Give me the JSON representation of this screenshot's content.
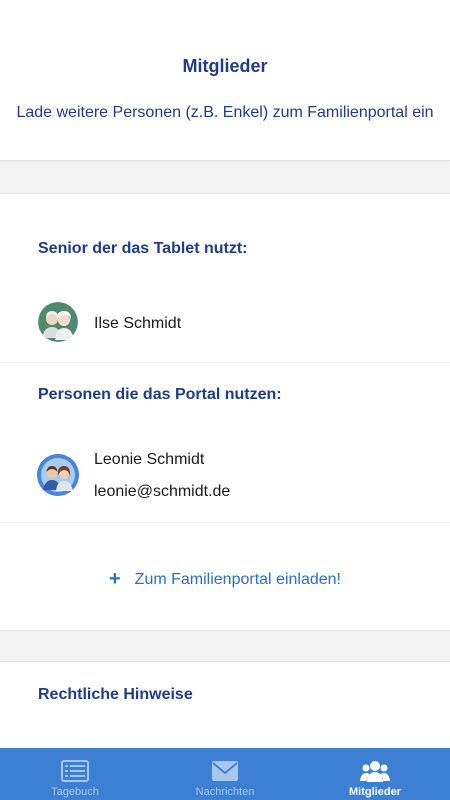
{
  "header": {
    "title": "Mitglieder",
    "subtitle": "Lade weitere Personen (z.B. Enkel) zum Familienportal ein"
  },
  "senior_section": {
    "title": "Senior der das Tablet nutzt:",
    "member": {
      "name": "Ilse Schmidt",
      "avatar": "senior-couple-avatar"
    }
  },
  "portal_section": {
    "title": "Personen die das Portal nutzen:",
    "members": [
      {
        "name": "Leonie Schmidt",
        "email": "leonie@schmidt.de",
        "avatar": "family-avatar"
      }
    ]
  },
  "invite": {
    "icon": "plus-icon",
    "label": "Zum Familienportal einladen!"
  },
  "legal": {
    "title": "Rechtliche Hinweise"
  },
  "bottom_nav": {
    "items": [
      {
        "label": "Tagebuch",
        "icon": "diary-icon",
        "active": false
      },
      {
        "label": "Nachrichten",
        "icon": "mail-icon",
        "active": false
      },
      {
        "label": "Mitglieder",
        "icon": "members-icon",
        "active": true
      }
    ]
  },
  "colors": {
    "primary_text": "#1e3d84",
    "link": "#2a6fc9",
    "nav_background": "#3c7fd3",
    "page_background": "#f3f3f3"
  }
}
